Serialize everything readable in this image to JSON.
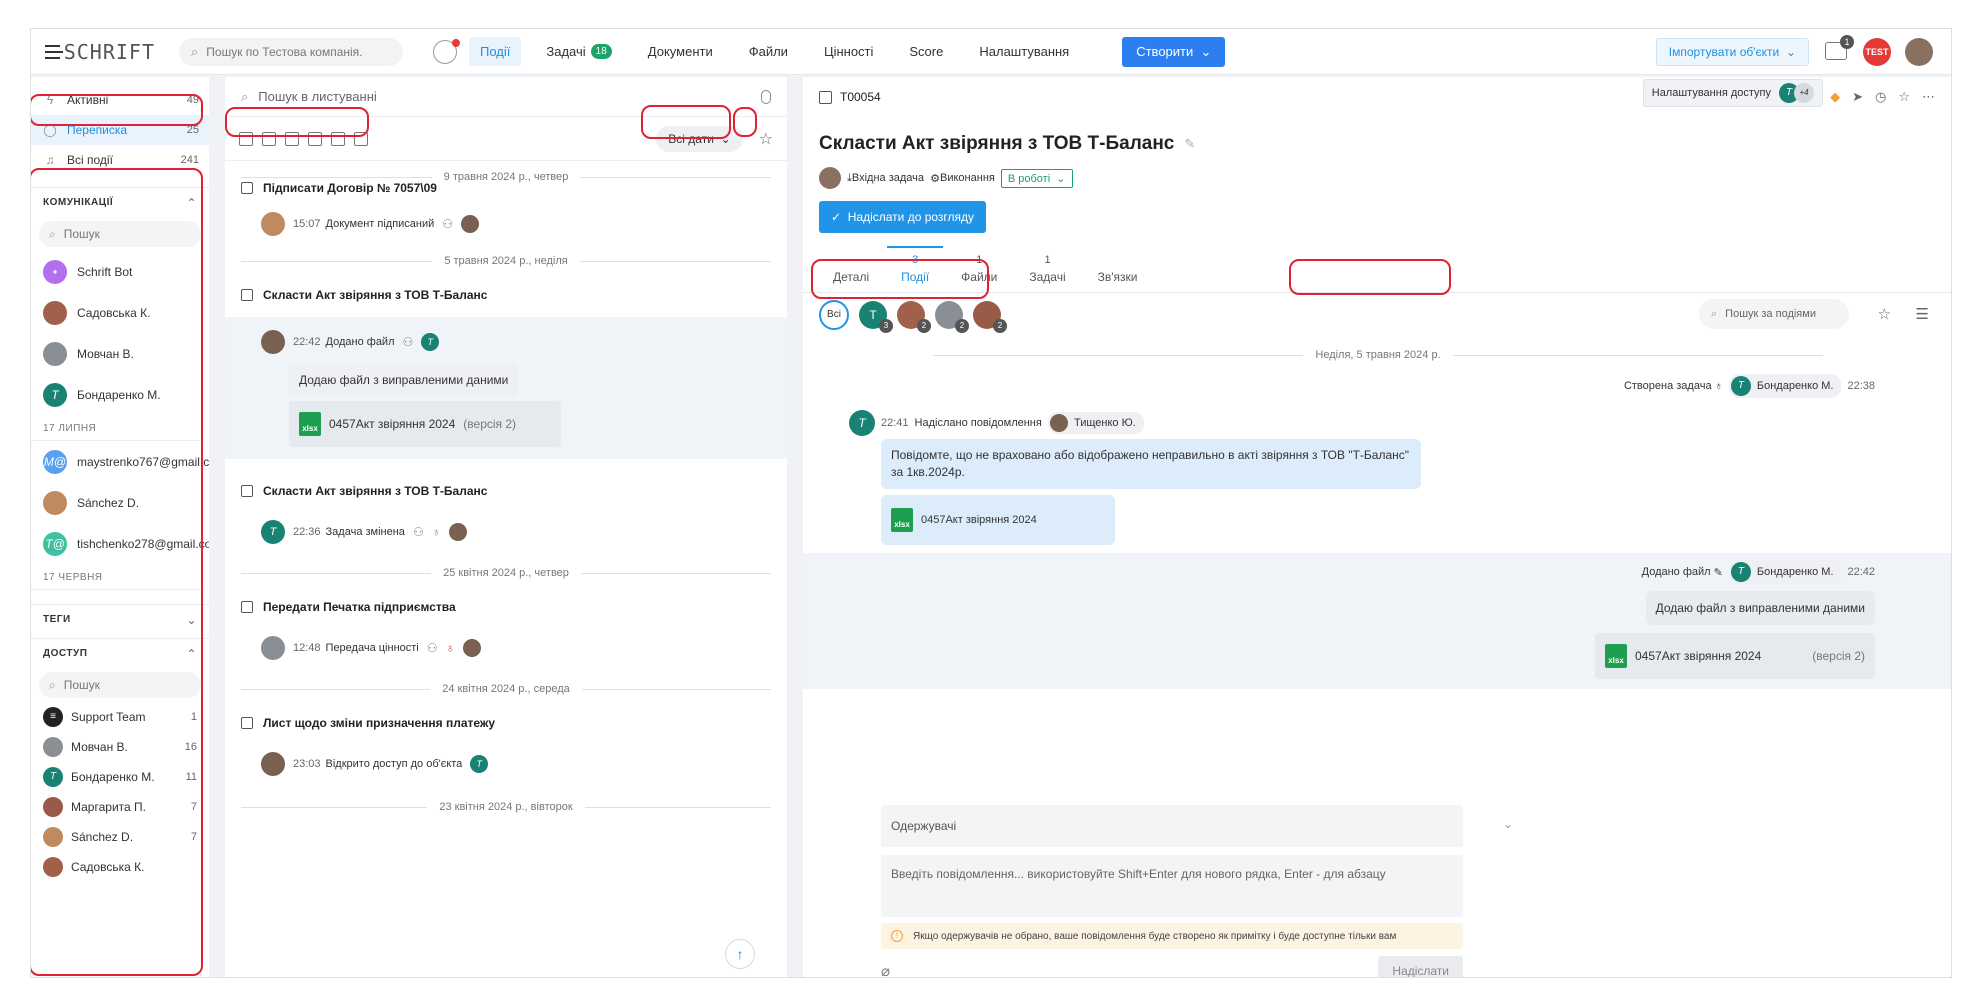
{
  "topbar": {
    "logo": "SCHRIFT",
    "search_placeholder": "Пошук по Тестова компанія.",
    "nav": [
      {
        "label": "Події",
        "active": true
      },
      {
        "label": "Задачі",
        "badge": "18"
      },
      {
        "label": "Документи"
      },
      {
        "label": "Файли"
      },
      {
        "label": "Цінності"
      },
      {
        "label": "Score"
      },
      {
        "label": "Налаштування"
      }
    ],
    "create_label": "Створити",
    "import_label": "Імпортувати об'єкти",
    "bag_count": "1",
    "test_badge": "TEST"
  },
  "sidebar": {
    "top": [
      {
        "label": "Активні",
        "count": "49",
        "icon": "bolt-icon"
      },
      {
        "label": "Переписка",
        "count": "25",
        "icon": "chat-icon",
        "active": true
      },
      {
        "label": "Всі події",
        "count": "241",
        "icon": "bell-icon"
      }
    ],
    "comm_title": "КОМУНІКАЦІЇ",
    "search_placeholder": "Пошук",
    "contacts": [
      {
        "name": "Schrift Bot",
        "color": "#b46ef0",
        "letter": "•"
      },
      {
        "name": "Садовська К.",
        "color": "#a0604a",
        "letter": ""
      },
      {
        "name": "Мовчан В.",
        "color": "#8a8f96",
        "letter": ""
      },
      {
        "name": "Бондаренко М.",
        "color": "#198373",
        "letter": "T"
      }
    ],
    "date1": "17 ЛИПНЯ",
    "contacts2": [
      {
        "name": "maystrenko767@gmail.com",
        "color": "#5aa0f0",
        "letter": "M@"
      },
      {
        "name": "Sánchez D.",
        "color": "#c08a60",
        "letter": ""
      },
      {
        "name": "tishchenko278@gmail.com",
        "color": "#3fc0a0",
        "letter": "T@"
      }
    ],
    "date2": "17 ЧЕРВНЯ",
    "tags_title": "ТЕГИ",
    "access_title": "ДОСТУП",
    "access_search": "Пошук",
    "access": [
      {
        "name": "Support Team",
        "count": "1",
        "color": "#222",
        "letter": "≡"
      },
      {
        "name": "Мовчан В.",
        "count": "16",
        "color": "#8a8f96",
        "letter": ""
      },
      {
        "name": "Бондаренко М.",
        "count": "11",
        "color": "#198373",
        "letter": "T"
      },
      {
        "name": "Маргарита П.",
        "count": "7",
        "color": "#9a5a48",
        "letter": ""
      },
      {
        "name": "Sánchez D.",
        "count": "7",
        "color": "#c08a60",
        "letter": ""
      },
      {
        "name": "Садовська К.",
        "count": "",
        "color": "#a0604a",
        "letter": ""
      }
    ]
  },
  "mid": {
    "search_placeholder": "Пошук в листуванні",
    "dates_label": "Всі дати",
    "d1": "9 травня 2024 р., четвер",
    "ev1_title": "Підписати Договір № 7057\\09",
    "ev1_time": "15:07",
    "ev1_text": "Документ підписаний",
    "d2": "5 травня 2024 р., неділя",
    "ev2_title": "Скласти Акт звіряння з ТОВ Т-Баланс",
    "ev2_time": "22:42",
    "ev2_text": "Додано файл",
    "ev2_msg": "Додаю файл з виправленими даними",
    "ev2_file": "0457Акт звіряння 2024",
    "ev2_ver": "(версія 2)",
    "ev3_title": "Скласти Акт звіряння з ТОВ Т-Баланс",
    "ev3_time": "22:36",
    "ev3_text": "Задача змінена",
    "d3": "25 квітня 2024 р., четвер",
    "ev4_title": "Передати Печатка підприємства",
    "ev4_time": "12:48",
    "ev4_text": "Передача цінності",
    "d4": "24 квітня 2024 р., середа",
    "ev5_title": "Лист щодо зміни призначення платежу",
    "ev5_time": "23:03",
    "ev5_text": "Відкрито доступ до об'єкта",
    "d5": "23 квітня 2024 р., вівторок"
  },
  "right": {
    "code": "T00054",
    "access_label": "Налаштування доступу",
    "access_more": "+4",
    "title": "Скласти Акт звіряння з ТОВ Т-Баланс",
    "task_type": "Вхідна задача",
    "exec": "Виконання",
    "status": "В роботі",
    "send_review": "Надіслати до розгляду",
    "tabs": [
      {
        "n": "",
        "label": "Деталі"
      },
      {
        "n": "3",
        "label": "Події",
        "active": true
      },
      {
        "n": "1",
        "label": "Файли"
      },
      {
        "n": "1",
        "label": "Задачі"
      },
      {
        "n": "",
        "label": "Зв'язки"
      }
    ],
    "filter_all": "Всі",
    "filter_avatars": [
      {
        "letter": "T",
        "count": "3",
        "color": "#198373"
      },
      {
        "letter": "",
        "count": "2",
        "color": "#a0604a"
      },
      {
        "letter": "",
        "count": "2",
        "color": "#8a8f96"
      },
      {
        "letter": "",
        "count": "2",
        "color": "#9a5a48"
      }
    ],
    "event_search": "Пошук за подіями",
    "date": "Неділя, 5 травня 2024 р.",
    "created_label": "Створена задача",
    "created_by": "Бондаренко М.",
    "created_time": "22:38",
    "msg_time": "22:41",
    "msg_label": "Надіслано повідомлення",
    "msg_to": "Тищенко Ю.",
    "msg_text": "Повідомте, що не враховано або відображено неправильно в акті звіряння з ТОВ \"Т-Баланс\" за 1кв.2024р.",
    "msg_file": "0457Акт звіряння 2024",
    "file_label": "Додано файл",
    "file_by": "Бондаренко М.",
    "file_time": "22:42",
    "file_msg": "Додаю файл з виправленими даними",
    "file_name": "0457Акт звіряння 2024",
    "file_ver": "(версія 2)",
    "recipients": "Одержувачі",
    "compose_placeholder": "Введіть повідомлення... використовуйте Shift+Enter для нового рядка, Enter - для абзацу",
    "warning": "Якщо одержувачів не обрано, ваше повідомлення буде створено як примітку і буде доступне тільки вам",
    "send": "Надіслати"
  },
  "colors": {
    "accent": "#1e8fe1",
    "highlight": "#e02232",
    "green": "#17a56a"
  }
}
